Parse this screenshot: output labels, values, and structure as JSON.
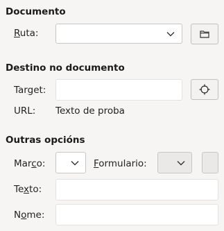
{
  "sections": {
    "documento": {
      "title": "Documento",
      "ruta_label_pre": "",
      "ruta_label_u": "R",
      "ruta_label_post": "uta:",
      "ruta_value": ""
    },
    "destino": {
      "title": "Destino no documento",
      "target_label_pre": "Tar",
      "target_label_u": "g",
      "target_label_post": "et:",
      "target_value": "",
      "url_label": "URL:",
      "url_value": "Texto de proba"
    },
    "outras": {
      "title": "Outras opcións",
      "marco_label_pre": "Mar",
      "marco_label_u": "c",
      "marco_label_post": "o:",
      "marco_value": "",
      "formulario_label_pre": "",
      "formulario_label_u": "F",
      "formulario_label_post": "ormulario:",
      "formulario_value": "",
      "texto_label_pre": "Te",
      "texto_label_u": "x",
      "texto_label_post": "to:",
      "texto_value": "",
      "nome_label_pre": "N",
      "nome_label_u": "o",
      "nome_label_post": "me:",
      "nome_value": ""
    }
  },
  "icons": {
    "browse": "folder-icon",
    "target_picker": "crosshair-icon",
    "dropdown": "chevron-down-icon"
  }
}
